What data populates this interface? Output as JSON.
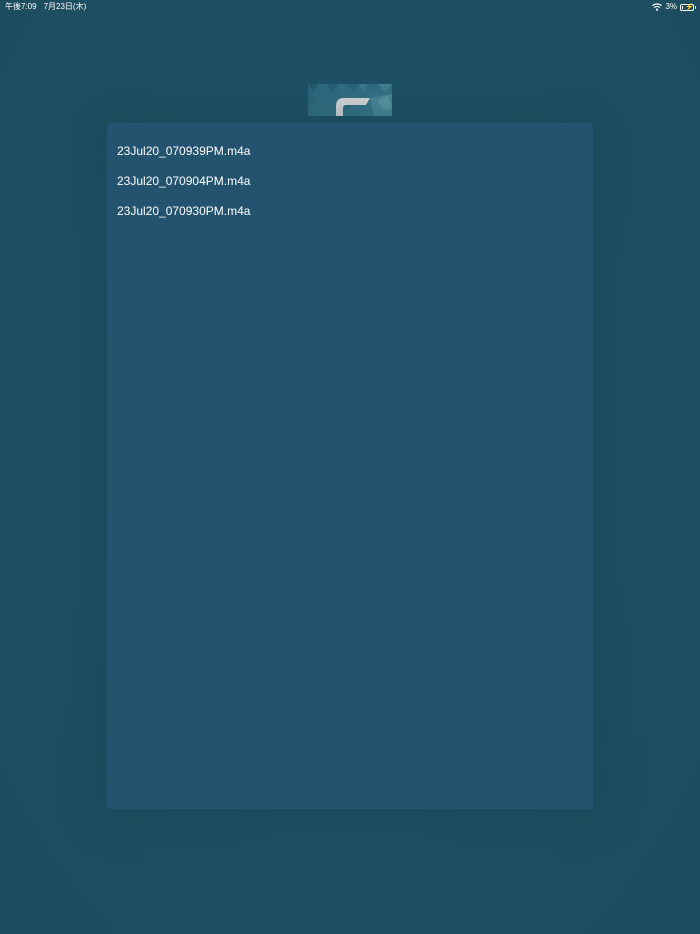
{
  "status_bar": {
    "time": "午後7:09",
    "date": "7月23日(木)",
    "battery_percent": "3%",
    "battery_level": 0.03,
    "wifi_icon": "wifi-icon",
    "battery_icon": "battery-charging-icon"
  },
  "logo": {
    "icon": "app-logo-icon"
  },
  "recordings": {
    "items": [
      {
        "filename": "23Jul20_070939PM.m4a"
      },
      {
        "filename": "23Jul20_070904PM.m4a"
      },
      {
        "filename": "23Jul20_070930PM.m4a"
      }
    ]
  },
  "colors": {
    "background": "#1e5064",
    "panel": "#23536f",
    "text": "#ffffff"
  }
}
